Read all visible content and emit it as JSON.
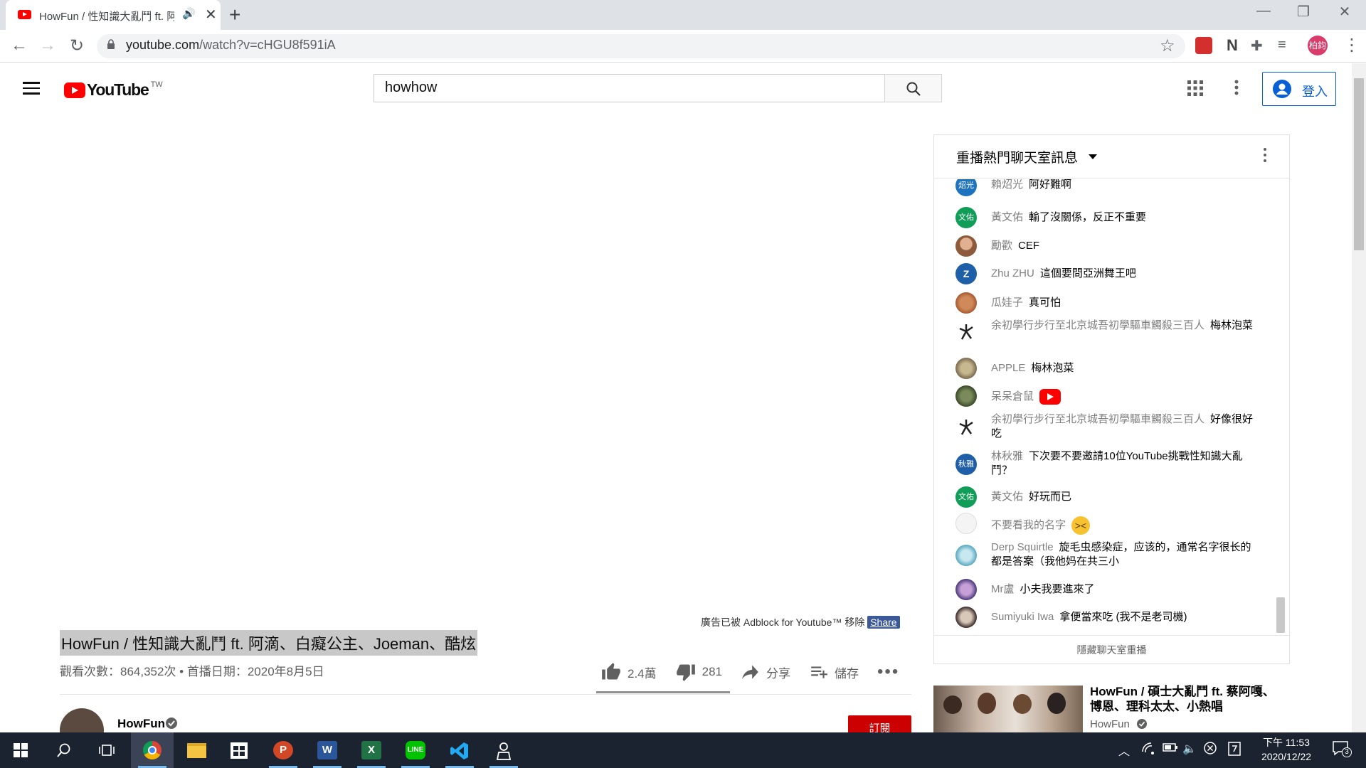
{
  "browser": {
    "tab_title": "HowFun / 性知識大亂鬥 ft. 阿",
    "url_host": "youtube.com",
    "url_path": "/watch?v=cHGU8f591iA",
    "profile_initials": "柏鈞"
  },
  "youtube": {
    "logo_text": "YouTube",
    "region": "TW",
    "search_value": "howhow",
    "signin_label": "登入"
  },
  "video": {
    "adblock_notice": "廣告已被 Adblock for Youtube™ 移除",
    "share_label": "Share",
    "title": "HowFun / 性知識大亂鬥 ft. 阿滴、白癡公主、Joeman、酷炫",
    "views_date": "觀看次數：864,352次 • 首播日期：2020年8月5日",
    "likes": "2.4萬",
    "dislikes": "281",
    "share": "分享",
    "save": "儲存",
    "channel_name": "HowFun",
    "subscribe_label": "訂閱"
  },
  "chat": {
    "title": "重播熱門聊天室訊息",
    "hide_label": "隱藏聊天室重播",
    "messages": [
      {
        "author": "賴炤光",
        "text": "阿好難啊",
        "avatar": "炤光",
        "color": "#1e73be"
      },
      {
        "author": "黃文佑",
        "text": "輸了沒關係，反正不重要",
        "avatar": "文佑",
        "color": "#0f9d58"
      },
      {
        "author": "勵歡",
        "text": "CEF",
        "avatar": "",
        "color": "#8d5a3c"
      },
      {
        "author": "Zhu ZHU",
        "text": "這個要問亞洲舞王吧",
        "avatar": "Z",
        "color": "#1e5fa8"
      },
      {
        "author": "瓜娃子",
        "text": "真可怕",
        "avatar": "",
        "color": "#b8663c"
      },
      {
        "author": "余初學行步行至北京城吾初學驅車觸殺三百人",
        "text": "梅林泡菜",
        "avatar": "",
        "color": "#ffffff"
      },
      {
        "author": "APPLE",
        "text": "梅林泡菜",
        "avatar": "",
        "color": "#9a8a70"
      },
      {
        "author": "呆呆倉鼠",
        "text": "",
        "avatar": "",
        "color": "#4a5a3a"
      },
      {
        "author": "余初學行步行至北京城吾初學驅車觸殺三百人",
        "text": "好像很好吃",
        "avatar": "",
        "color": "#ffffff"
      },
      {
        "author": "林秋雅",
        "text": "下次要不要邀請10位YouTube挑戰性知識大亂鬥？",
        "avatar": "秋雅",
        "color": "#1e5fa8"
      },
      {
        "author": "黃文佑",
        "text": "好玩而已",
        "avatar": "文佑",
        "color": "#0f9d58"
      },
      {
        "author": "不要看我的名字",
        "text": "",
        "avatar": "",
        "color": "#f4f4f4"
      },
      {
        "author": "Derp Squirtle",
        "text": "旋毛虫感染症，应该的，通常名字很长的都是答案（我他妈在共三小",
        "avatar": "",
        "color": "#8fc3d0"
      },
      {
        "author": "Mr盧",
        "text": "小夫我要進來了",
        "avatar": "",
        "color": "#5a4a8a"
      },
      {
        "author": "Sumiyuki Iwa",
        "text": "拿便當來吃 (我不是老司機)",
        "avatar": "",
        "color": "#4a3a3a"
      }
    ]
  },
  "recommendation": {
    "title": "HowFun / 碩士大亂鬥 ft. 蔡阿嘎、博恩、理科太太、小熱唱",
    "channel": "HowFun"
  },
  "taskbar": {
    "time": "下午 11:53",
    "date": "2020/12/22",
    "notif_count": "3"
  }
}
